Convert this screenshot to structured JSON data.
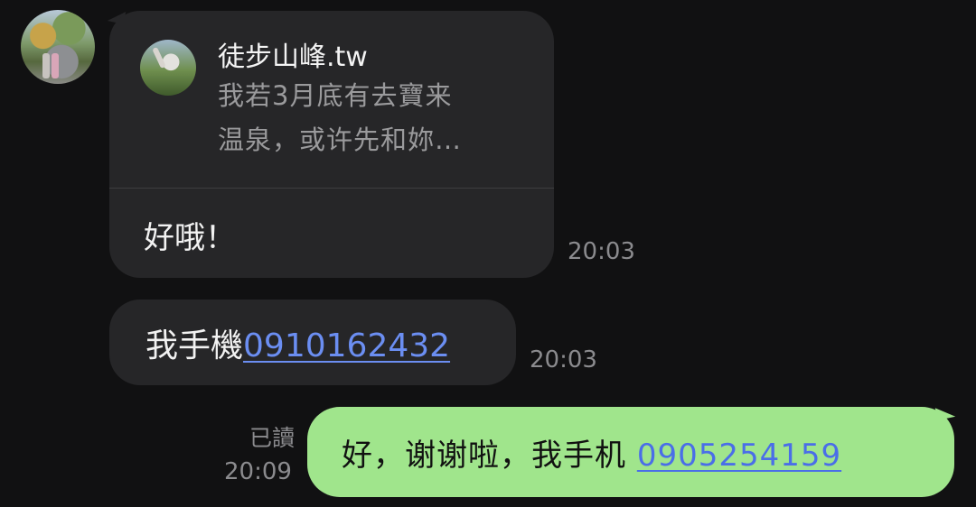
{
  "contact": {
    "avatar_icon": "contact-avatar-photo"
  },
  "messages": [
    {
      "direction": "incoming",
      "reply_to": {
        "name": "徒步山峰.tw",
        "text_line1": "我若3月底有去寶来",
        "text_line2": "温泉，或许先和妳…"
      },
      "text": "好哦！",
      "time": "20:03"
    },
    {
      "direction": "incoming",
      "text_prefix": "我手機",
      "phone_link": "0910162432",
      "time": "20:03"
    },
    {
      "direction": "outgoing",
      "read_label": "已讀",
      "text_prefix": "好，谢谢啦，我手机 ",
      "phone_link": "0905254159",
      "time": "20:09"
    }
  ],
  "colors": {
    "background": "#111112",
    "incoming_bubble": "#262628",
    "outgoing_bubble": "#a0e58c",
    "link": "#6b8ef2",
    "meta_text": "#8b8b8e"
  }
}
